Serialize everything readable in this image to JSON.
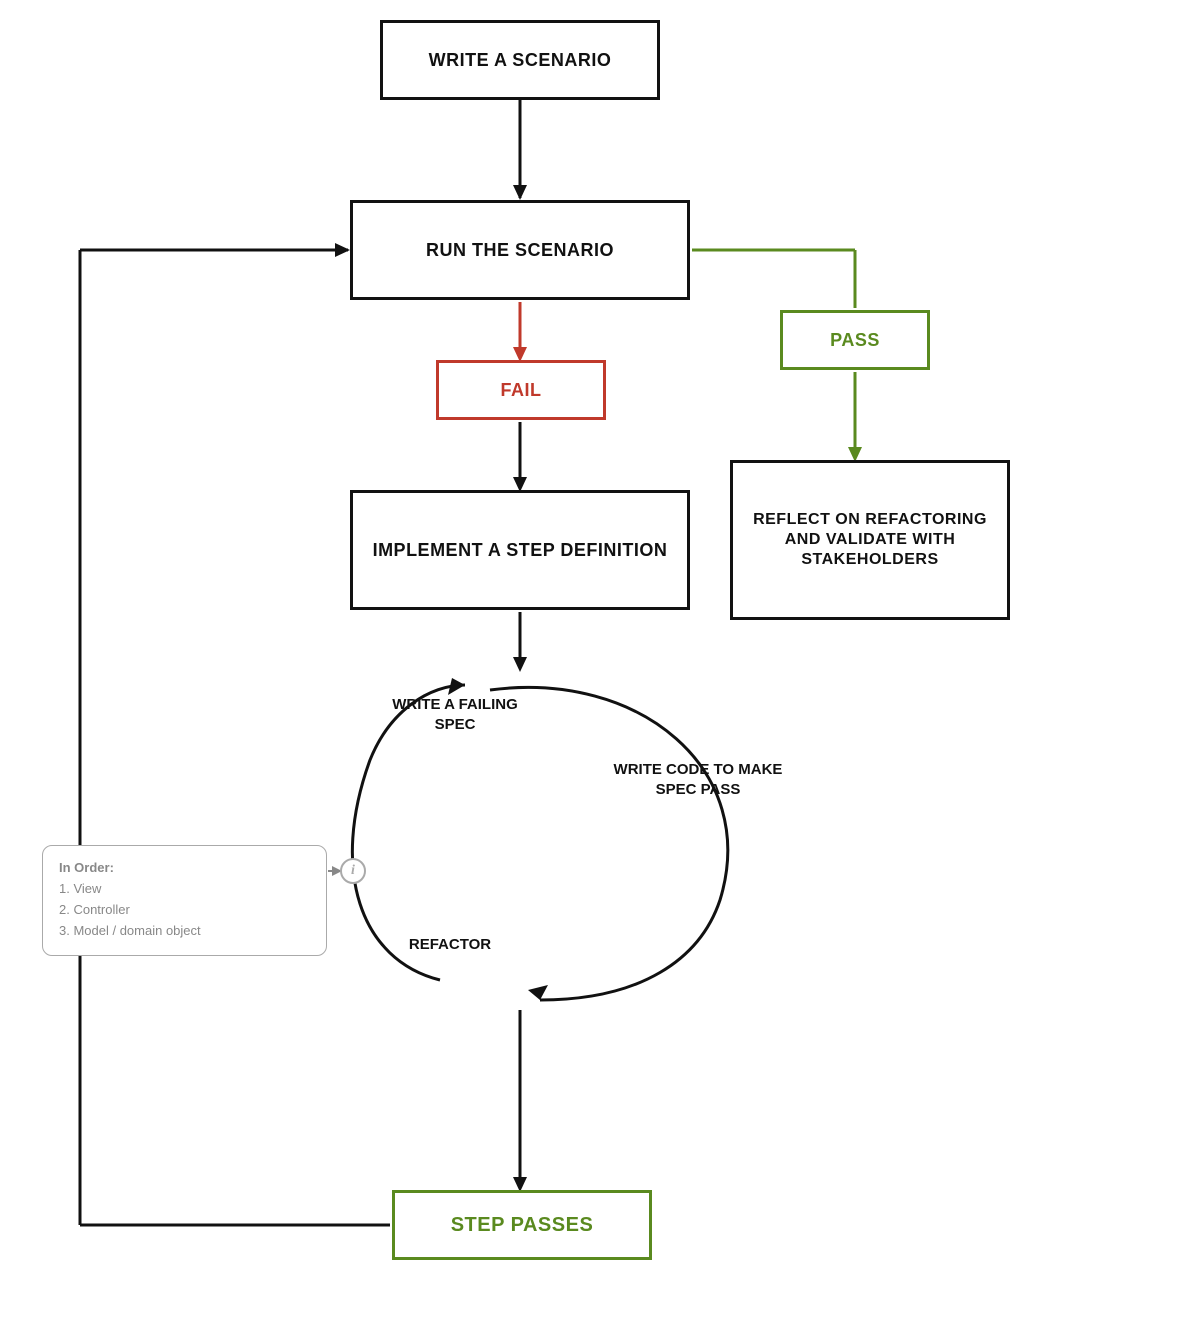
{
  "boxes": {
    "write_scenario": "WRITE A SCENARIO",
    "run_scenario": "RUN THE SCENARIO",
    "fail": "FAIL",
    "pass": "PASS",
    "implement": "IMPLEMENT A STEP DEFINITION",
    "reflect": "REFLECT ON REFACTORING AND VALIDATE WITH STAKEHOLDERS",
    "step_passes": "STEP PASSES"
  },
  "labels": {
    "failing_spec": "WRITE A FAILING SPEC",
    "write_code": "WRITE CODE TO MAKE SPEC PASS",
    "refactor": "REFACTOR"
  },
  "info_box": {
    "title": "In Order:",
    "items": [
      "1. View",
      "2. Controller",
      "3. Model / domain object"
    ]
  },
  "colors": {
    "black": "#111111",
    "red": "#c0392b",
    "green": "#5a8a1f",
    "gray": "#888888"
  }
}
